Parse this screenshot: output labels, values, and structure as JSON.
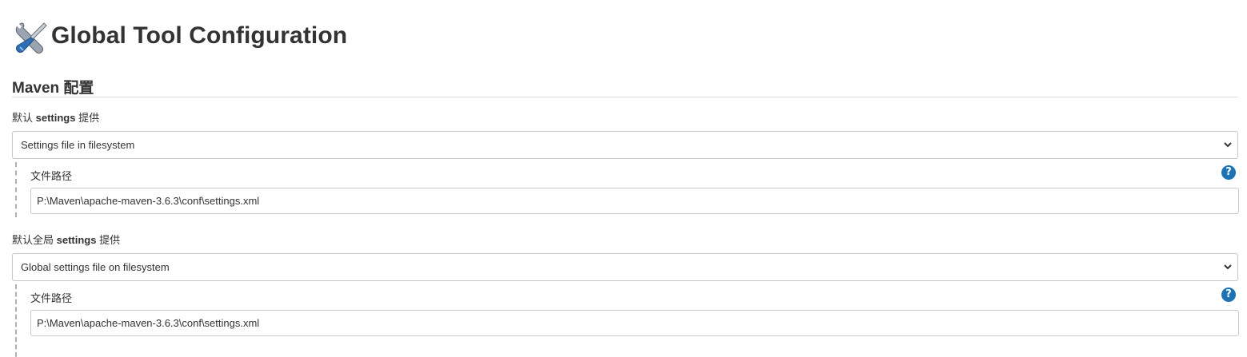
{
  "page": {
    "title": "Global Tool Configuration",
    "icon": "tools-icon"
  },
  "maven_section": {
    "title": "Maven 配置",
    "default_settings": {
      "label_prefix": "默认 ",
      "label_bold": "settings",
      "label_suffix": " 提供",
      "selected": "Settings file in filesystem",
      "path_label": "文件路径",
      "path_value": "P:\\Maven\\apache-maven-3.6.3\\conf\\settings.xml"
    },
    "global_settings": {
      "label_prefix": "默认全局 ",
      "label_bold": "settings",
      "label_suffix": " 提供",
      "selected": "Global settings file on filesystem",
      "path_label": "文件路径",
      "path_value": "P:\\Maven\\apache-maven-3.6.3\\conf\\settings.xml"
    }
  },
  "help_glyph": "?",
  "colors": {
    "help": "#1d73b4",
    "text": "#333333",
    "border": "#c8c8c8"
  }
}
